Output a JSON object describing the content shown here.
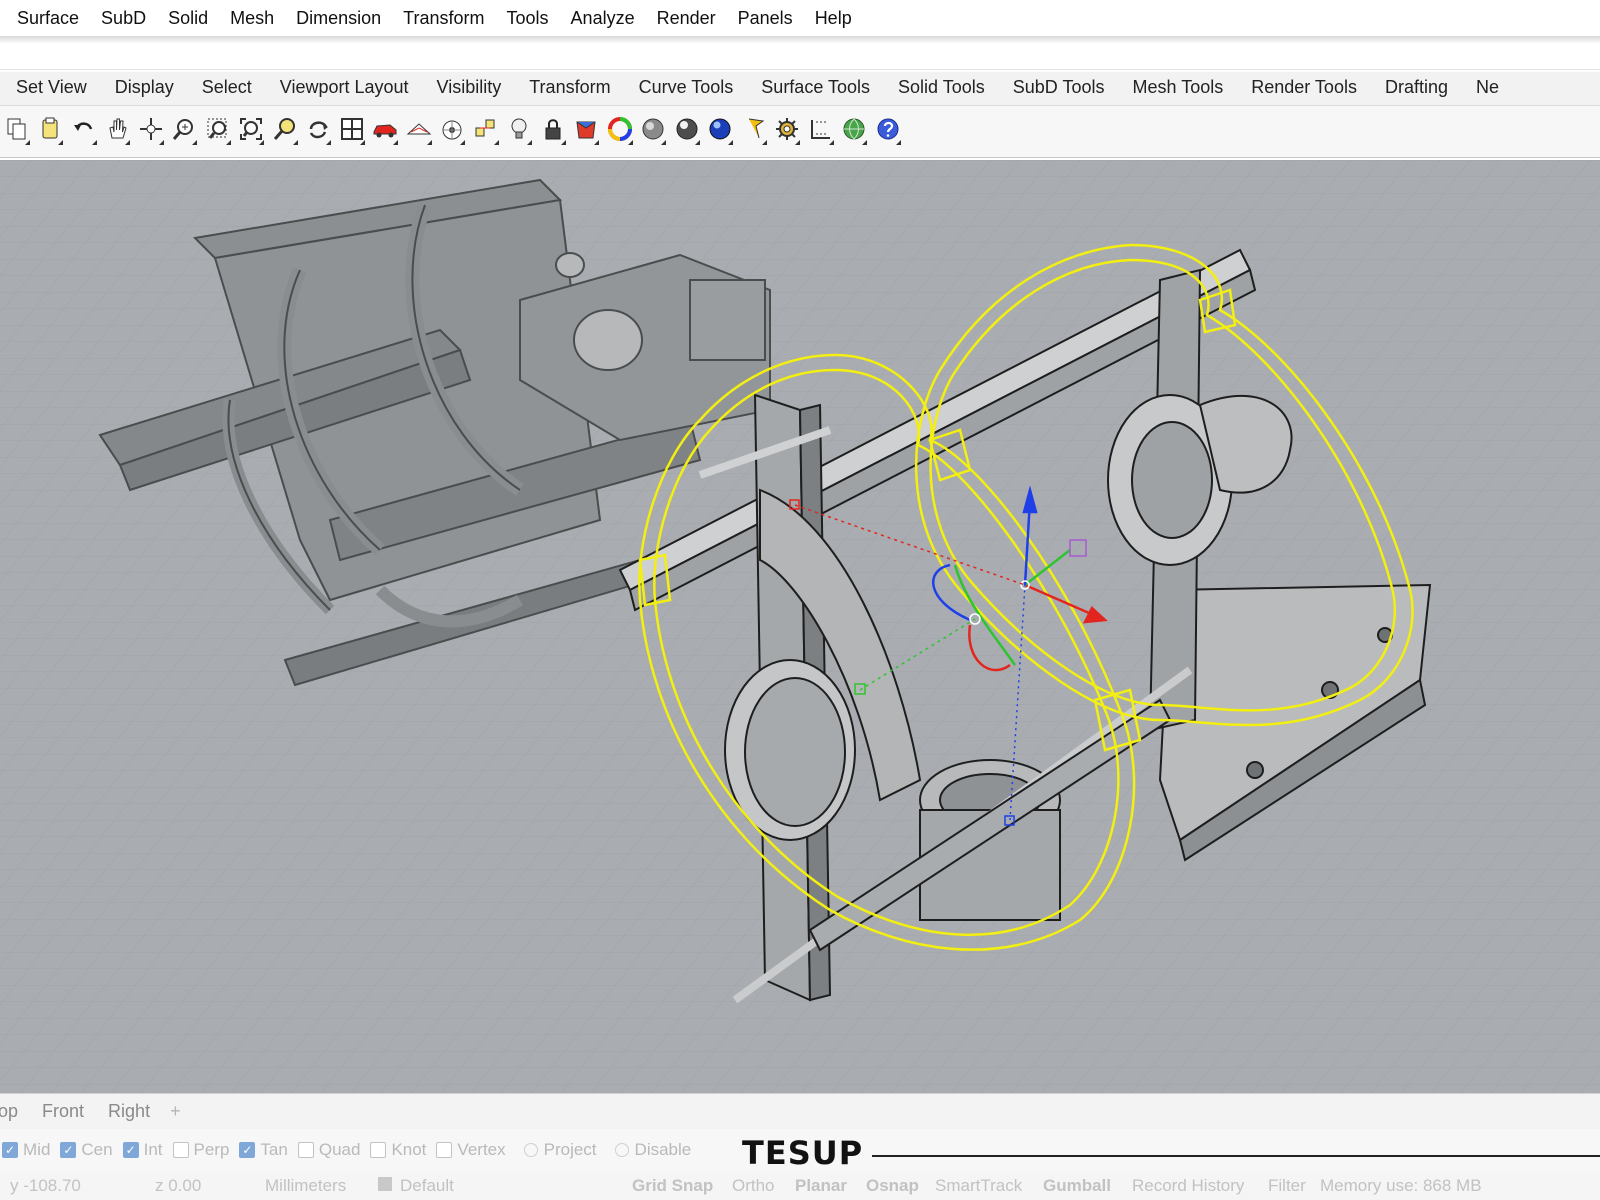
{
  "menu": {
    "items": [
      "Surface",
      "SubD",
      "Solid",
      "Mesh",
      "Dimension",
      "Transform",
      "Tools",
      "Analyze",
      "Render",
      "Panels",
      "Help"
    ]
  },
  "command": {
    "value": ""
  },
  "toolbar_tabs": [
    "Set View",
    "Display",
    "Select",
    "Viewport Layout",
    "Visibility",
    "Transform",
    "Curve Tools",
    "Surface Tools",
    "Solid Tools",
    "SubD Tools",
    "Mesh Tools",
    "Render Tools",
    "Drafting",
    "Ne"
  ],
  "tools": [
    {
      "icon": "copy-icon"
    },
    {
      "icon": "paste-icon"
    },
    {
      "icon": "undo-icon"
    },
    {
      "icon": "pan-hand-icon"
    },
    {
      "icon": "move-view-icon"
    },
    {
      "icon": "zoom-dynamic-icon"
    },
    {
      "icon": "zoom-window-icon"
    },
    {
      "icon": "zoom-extents-icon"
    },
    {
      "icon": "zoom-selected-icon"
    },
    {
      "icon": "rotate-view-icon"
    },
    {
      "icon": "four-viewports-icon"
    },
    {
      "icon": "car-icon"
    },
    {
      "icon": "named-views-icon"
    },
    {
      "icon": "cplane-icon"
    },
    {
      "icon": "osnap-icon"
    },
    {
      "icon": "light-bulb-icon"
    },
    {
      "icon": "lock-icon"
    },
    {
      "icon": "material-icon"
    },
    {
      "icon": "color-wheel-icon"
    },
    {
      "icon": "shaded-sphere-icon"
    },
    {
      "icon": "rendered-sphere-icon"
    },
    {
      "icon": "render-sphere-icon"
    },
    {
      "icon": "flag-pin-icon"
    },
    {
      "icon": "gear-icon"
    },
    {
      "icon": "dimension-icon"
    },
    {
      "icon": "globe-icon"
    },
    {
      "icon": "help-icon"
    }
  ],
  "viewport_tabs": [
    "op",
    "Front",
    "Right"
  ],
  "viewport_add": "+",
  "osnaps": [
    {
      "label": "Mid",
      "checked": true
    },
    {
      "label": "Cen",
      "checked": true
    },
    {
      "label": "Int",
      "checked": true
    },
    {
      "label": "Perp",
      "checked": false
    },
    {
      "label": "Tan",
      "checked": true
    },
    {
      "label": "Quad",
      "checked": false
    },
    {
      "label": "Knot",
      "checked": false
    },
    {
      "label": "Vertex",
      "checked": false
    }
  ],
  "osnap_extra": [
    "Project",
    "Disable"
  ],
  "brand": "TESUP",
  "status": {
    "y": "y -108.70",
    "z": "z 0.00",
    "units": "Millimeters",
    "layer": "Default",
    "grid_snap": "Grid Snap",
    "ortho": "Ortho",
    "planar": "Planar",
    "osnap": "Osnap",
    "smarttrack": "SmartTrack",
    "gumball": "Gumball",
    "record_history": "Record History",
    "filter": "Filter",
    "memory": "Memory use: 868 MB"
  },
  "colors": {
    "viewport_bg": "#a9adb1",
    "selection": "#f3ef10",
    "gumball_x": "#e2261f",
    "gumball_y": "#2fc42f",
    "gumball_z": "#1f3fe8"
  }
}
